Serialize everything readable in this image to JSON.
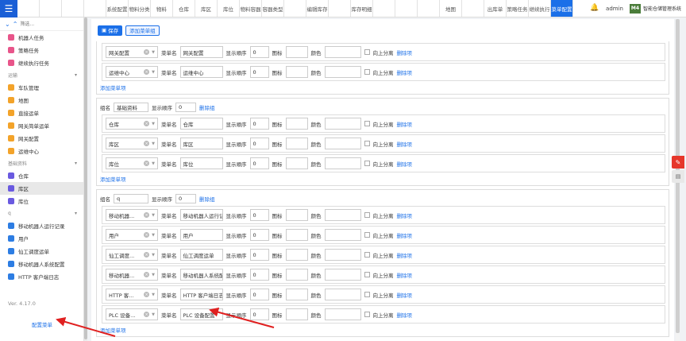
{
  "topbar": {
    "menu_icon": "hamburger-icon",
    "tabs": [
      "",
      "",
      "",
      "",
      "系统配置",
      "物料分类",
      "物料",
      "仓库",
      "库区",
      "库位",
      "物料容器",
      "容器类型",
      "",
      "编辑库存",
      "",
      "库存明细",
      "",
      "",
      "",
      "地图",
      "",
      "出库单",
      "策略任务",
      "继续执行",
      "菜单配置"
    ],
    "active_tab": 24,
    "user": "admin",
    "logo_text": "M4",
    "system_name": "智能仓储管理系统"
  },
  "sidebar": {
    "search_placeholder": "筛选...",
    "items_top": [
      {
        "label": "机器人任务",
        "color": "pink"
      },
      {
        "label": "策略任务",
        "color": "pink"
      },
      {
        "label": "继续执行任务",
        "color": "pink"
      }
    ],
    "group1": "运输",
    "items_g1": [
      {
        "label": "车队管理",
        "color": "orange"
      },
      {
        "label": "地图",
        "color": "orange"
      },
      {
        "label": "直接运单",
        "color": "orange"
      },
      {
        "label": "网关简单运单",
        "color": "orange"
      },
      {
        "label": "网关配置",
        "color": "orange"
      },
      {
        "label": "运维中心",
        "color": "orange"
      }
    ],
    "group2": "基础资料",
    "items_g2": [
      {
        "label": "仓库",
        "color": "purple"
      },
      {
        "label": "库区",
        "color": "purple",
        "active": true
      },
      {
        "label": "库位",
        "color": "purple"
      }
    ],
    "group3": "q",
    "items_g3": [
      {
        "label": "移动机器人运行记录",
        "color": "blue"
      },
      {
        "label": "用户",
        "color": "blue"
      },
      {
        "label": "仙工调度运单",
        "color": "blue"
      },
      {
        "label": "移动机器人系统配置",
        "color": "blue"
      },
      {
        "label": "HTTP 客户端日志",
        "color": "blue"
      }
    ],
    "version": "Ver. 4.17.0",
    "config_link": "配置菜单"
  },
  "toolbar": {
    "save_label": "保存",
    "add_group_label": "添加菜单组"
  },
  "labels": {
    "menu_name": "菜单名",
    "display_order": "显示顺序",
    "icon": "图标",
    "color": "颜色",
    "split_up": "向上分离",
    "delete_item": "删除项",
    "group_name": "组名",
    "delete_group": "删除组",
    "add_menu_item": "添加菜单项"
  },
  "groups": [
    {
      "name": null,
      "order": null,
      "items": [
        {
          "select": "网关配置",
          "name": "网关配置",
          "order": "0"
        },
        {
          "select": "运维中心",
          "name": "运维中心",
          "order": "0"
        }
      ]
    },
    {
      "name": "基础资料",
      "order": "0",
      "items": [
        {
          "select": "仓库",
          "name": "仓库",
          "order": "0"
        },
        {
          "select": "库区",
          "name": "库区",
          "order": "0"
        },
        {
          "select": "库位",
          "name": "库位",
          "order": "0"
        }
      ]
    },
    {
      "name": "q",
      "order": "0",
      "items": [
        {
          "select": "移动机器...",
          "name": "移动机器人运行记",
          "order": "0"
        },
        {
          "select": "用户",
          "name": "用户",
          "order": "0"
        },
        {
          "select": "仙工调度...",
          "name": "仙工调度运单",
          "order": "0"
        },
        {
          "select": "移动机器...",
          "name": "移动机器人系统配",
          "order": "0"
        },
        {
          "select": "HTTP 客...",
          "name": "HTTP 客户端日志",
          "order": "0"
        },
        {
          "select": "PLC 设备...",
          "name": "PLC 设备配置",
          "order": "0"
        }
      ]
    }
  ],
  "colors": {
    "accent": "#1a6fe8",
    "annotation_arrow": "#e02020"
  }
}
